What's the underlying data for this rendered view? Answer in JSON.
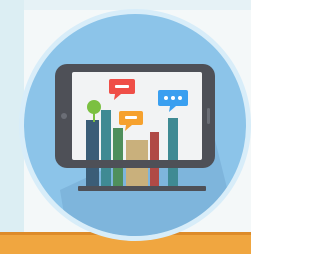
{
  "illustration": {
    "subject": "smartphone-with-chat-bubbles-icon",
    "colors": {
      "background_left": "#dceef3",
      "background_right": "#f4f8f9",
      "circle_fill": "#8cc4e9",
      "circle_ring": "#d8edf9",
      "circle_shadow": "#6fa6d0",
      "floor": "#f0a640",
      "floor_dark": "#dd8b2a",
      "phone_body": "#4e5057",
      "phone_screen": "#f2f3f4",
      "bubble_red": "#ef4e47",
      "bubble_blue": "#3a9ff0",
      "bubble_orange": "#f6a12e",
      "lamp_green": "#7bc041",
      "book_navy": "#3b5d77",
      "book_teal": "#3f8a93",
      "book_green": "#4f8f5c",
      "book_beige": "#c9b07c",
      "book_red": "#b04a46"
    }
  }
}
